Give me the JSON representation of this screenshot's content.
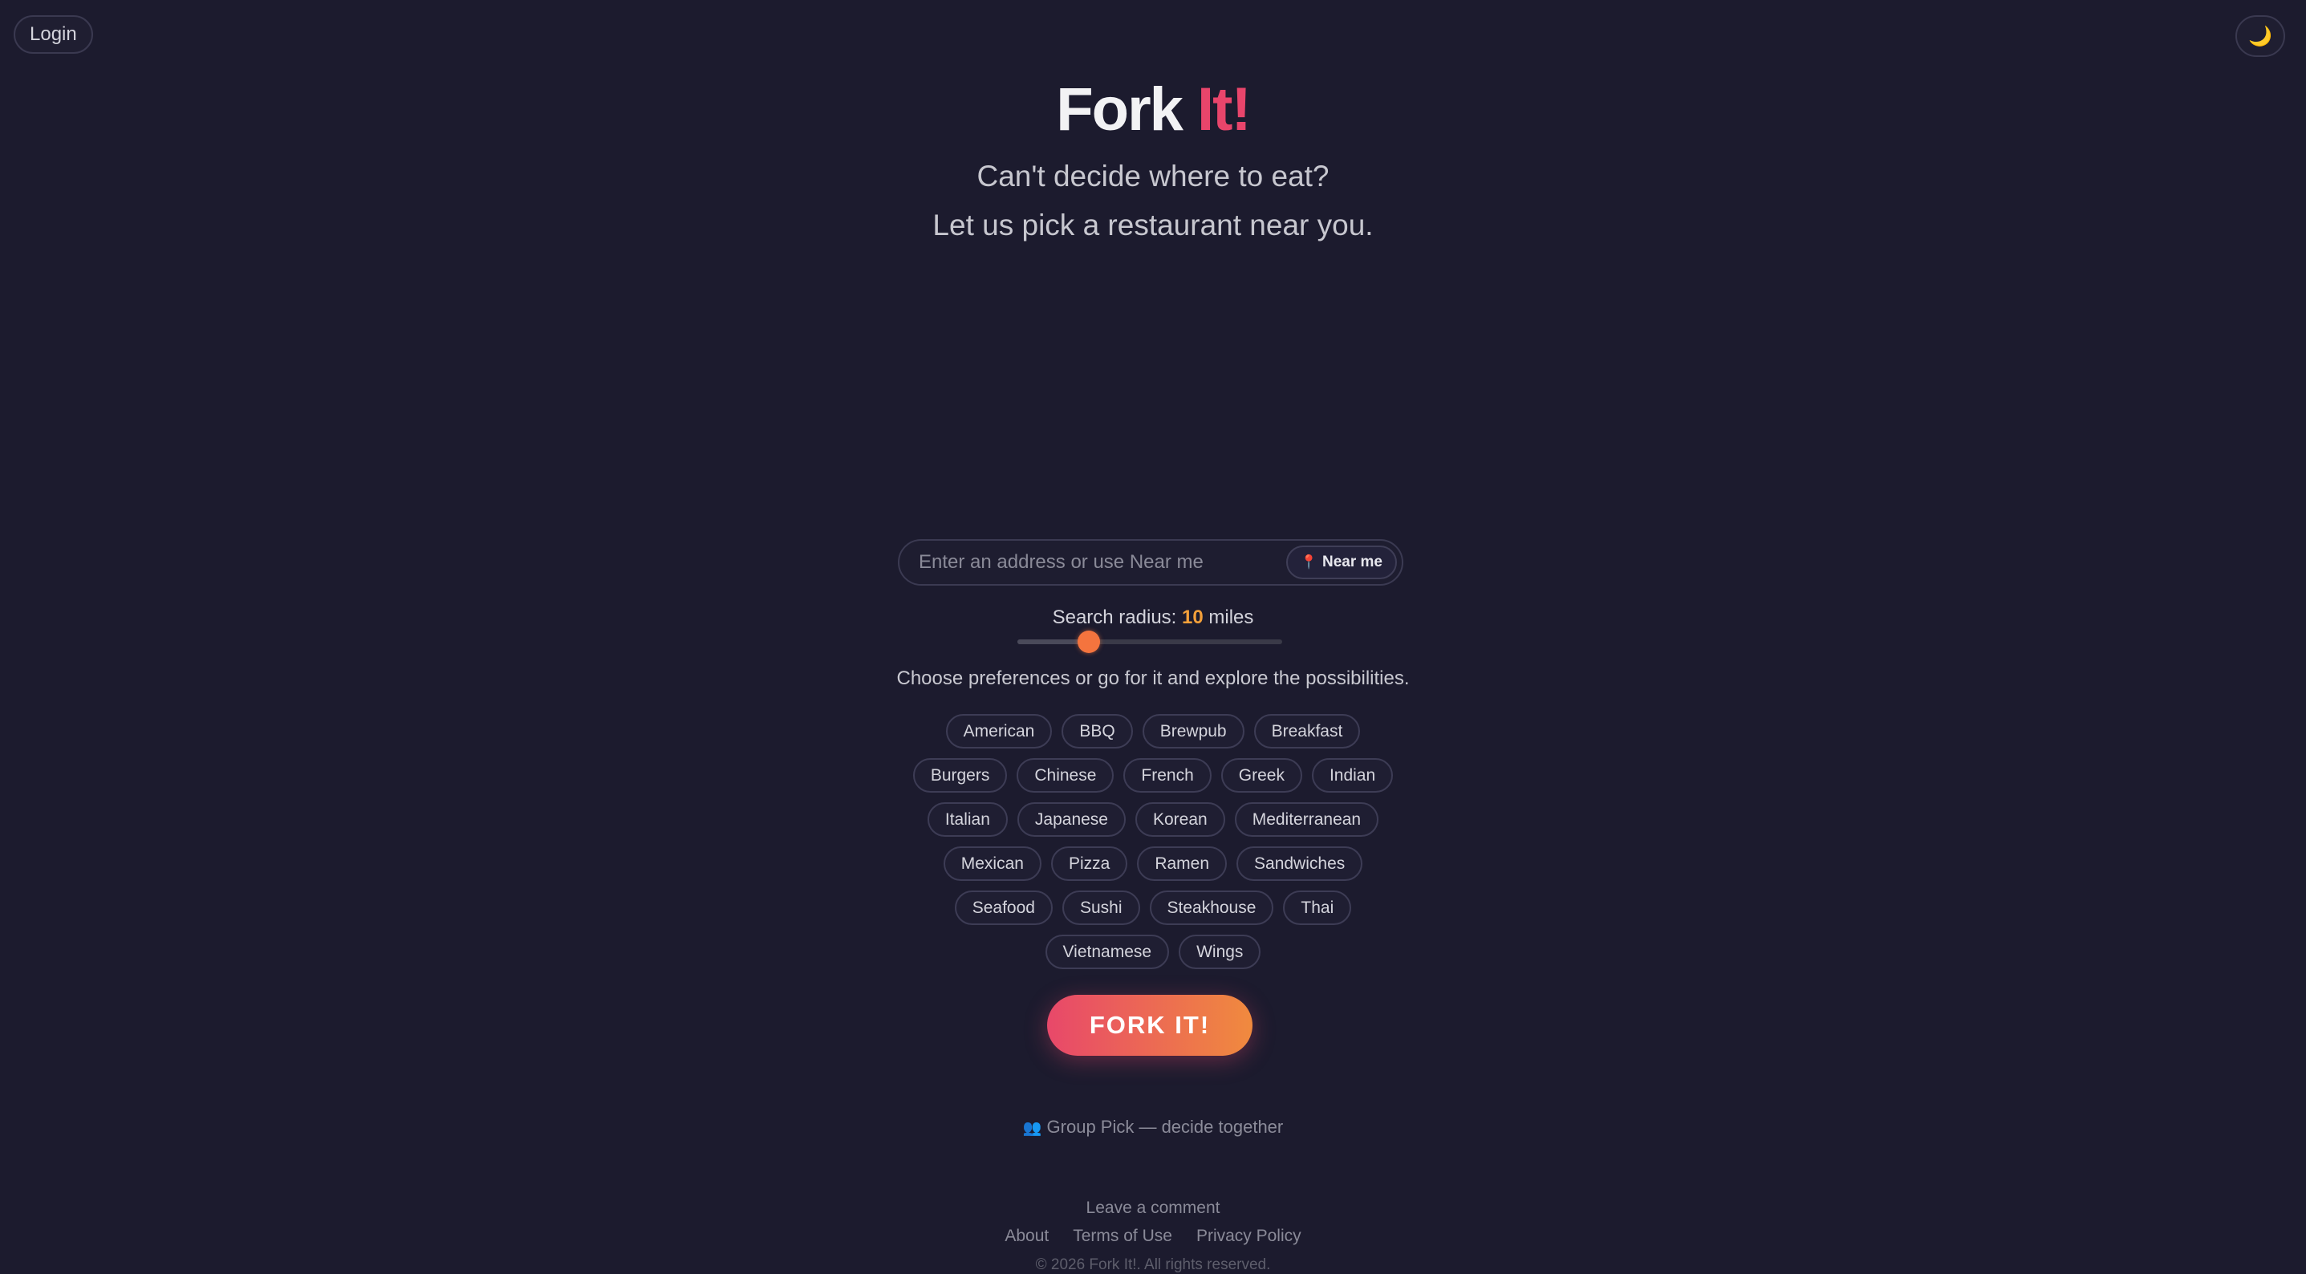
{
  "header": {
    "login_label": "Login",
    "theme_icon": "🌙"
  },
  "hero": {
    "title_part1": "Fork",
    "title_part2": "It!",
    "subtitle_line1": "Can't decide where to eat?",
    "subtitle_line2": "Let us pick a restaurant near you."
  },
  "search": {
    "placeholder": "Enter an address or use Near me",
    "value": "",
    "near_me_label": "Near me",
    "near_me_icon": "📍"
  },
  "radius": {
    "label_prefix": "Search radius:",
    "value": "10",
    "unit": "miles",
    "fraction": 0.27
  },
  "preferences": {
    "prompt": "Choose preferences or go for it and explore the possibilities.",
    "rows": [
      [
        "American",
        "BBQ",
        "Brewpub",
        "Breakfast"
      ],
      [
        "Burgers",
        "Chinese",
        "French",
        "Greek",
        "Indian"
      ],
      [
        "Italian",
        "Japanese",
        "Korean",
        "Mediterranean"
      ],
      [
        "Mexican",
        "Pizza",
        "Ramen",
        "Sandwiches"
      ],
      [
        "Seafood",
        "Sushi",
        "Steakhouse",
        "Thai"
      ],
      [
        "Vietnamese",
        "Wings"
      ]
    ]
  },
  "action": {
    "fork_label": "FORK IT!"
  },
  "group_pick": {
    "icon": "👥",
    "label": "Group Pick — decide together"
  },
  "footer": {
    "comment": "Leave a comment",
    "links": [
      "About",
      "Terms of Use",
      "Privacy Policy"
    ],
    "copyright": "© 2026 Fork It!. All rights reserved."
  },
  "colors": {
    "background": "#1c1b2e",
    "accent_pink": "#e8456b",
    "accent_orange": "#f4a03a"
  }
}
